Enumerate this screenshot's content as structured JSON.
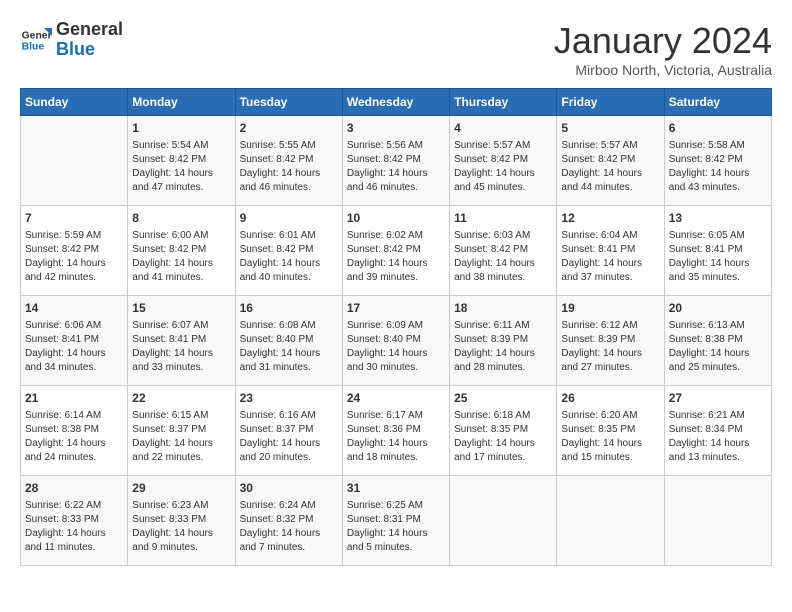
{
  "header": {
    "logo": {
      "line1": "General",
      "line2": "Blue"
    },
    "title": "January 2024",
    "subtitle": "Mirboo North, Victoria, Australia"
  },
  "weekdays": [
    "Sunday",
    "Monday",
    "Tuesday",
    "Wednesday",
    "Thursday",
    "Friday",
    "Saturday"
  ],
  "weeks": [
    [
      {
        "day": "",
        "info": ""
      },
      {
        "day": "1",
        "info": "Sunrise: 5:54 AM\nSunset: 8:42 PM\nDaylight: 14 hours\nand 47 minutes."
      },
      {
        "day": "2",
        "info": "Sunrise: 5:55 AM\nSunset: 8:42 PM\nDaylight: 14 hours\nand 46 minutes."
      },
      {
        "day": "3",
        "info": "Sunrise: 5:56 AM\nSunset: 8:42 PM\nDaylight: 14 hours\nand 46 minutes."
      },
      {
        "day": "4",
        "info": "Sunrise: 5:57 AM\nSunset: 8:42 PM\nDaylight: 14 hours\nand 45 minutes."
      },
      {
        "day": "5",
        "info": "Sunrise: 5:57 AM\nSunset: 8:42 PM\nDaylight: 14 hours\nand 44 minutes."
      },
      {
        "day": "6",
        "info": "Sunrise: 5:58 AM\nSunset: 8:42 PM\nDaylight: 14 hours\nand 43 minutes."
      }
    ],
    [
      {
        "day": "7",
        "info": "Sunrise: 5:59 AM\nSunset: 8:42 PM\nDaylight: 14 hours\nand 42 minutes."
      },
      {
        "day": "8",
        "info": "Sunrise: 6:00 AM\nSunset: 8:42 PM\nDaylight: 14 hours\nand 41 minutes."
      },
      {
        "day": "9",
        "info": "Sunrise: 6:01 AM\nSunset: 8:42 PM\nDaylight: 14 hours\nand 40 minutes."
      },
      {
        "day": "10",
        "info": "Sunrise: 6:02 AM\nSunset: 8:42 PM\nDaylight: 14 hours\nand 39 minutes."
      },
      {
        "day": "11",
        "info": "Sunrise: 6:03 AM\nSunset: 8:42 PM\nDaylight: 14 hours\nand 38 minutes."
      },
      {
        "day": "12",
        "info": "Sunrise: 6:04 AM\nSunset: 8:41 PM\nDaylight: 14 hours\nand 37 minutes."
      },
      {
        "day": "13",
        "info": "Sunrise: 6:05 AM\nSunset: 8:41 PM\nDaylight: 14 hours\nand 35 minutes."
      }
    ],
    [
      {
        "day": "14",
        "info": "Sunrise: 6:06 AM\nSunset: 8:41 PM\nDaylight: 14 hours\nand 34 minutes."
      },
      {
        "day": "15",
        "info": "Sunrise: 6:07 AM\nSunset: 8:41 PM\nDaylight: 14 hours\nand 33 minutes."
      },
      {
        "day": "16",
        "info": "Sunrise: 6:08 AM\nSunset: 8:40 PM\nDaylight: 14 hours\nand 31 minutes."
      },
      {
        "day": "17",
        "info": "Sunrise: 6:09 AM\nSunset: 8:40 PM\nDaylight: 14 hours\nand 30 minutes."
      },
      {
        "day": "18",
        "info": "Sunrise: 6:11 AM\nSunset: 8:39 PM\nDaylight: 14 hours\nand 28 minutes."
      },
      {
        "day": "19",
        "info": "Sunrise: 6:12 AM\nSunset: 8:39 PM\nDaylight: 14 hours\nand 27 minutes."
      },
      {
        "day": "20",
        "info": "Sunrise: 6:13 AM\nSunset: 8:38 PM\nDaylight: 14 hours\nand 25 minutes."
      }
    ],
    [
      {
        "day": "21",
        "info": "Sunrise: 6:14 AM\nSunset: 8:38 PM\nDaylight: 14 hours\nand 24 minutes."
      },
      {
        "day": "22",
        "info": "Sunrise: 6:15 AM\nSunset: 8:37 PM\nDaylight: 14 hours\nand 22 minutes."
      },
      {
        "day": "23",
        "info": "Sunrise: 6:16 AM\nSunset: 8:37 PM\nDaylight: 14 hours\nand 20 minutes."
      },
      {
        "day": "24",
        "info": "Sunrise: 6:17 AM\nSunset: 8:36 PM\nDaylight: 14 hours\nand 18 minutes."
      },
      {
        "day": "25",
        "info": "Sunrise: 6:18 AM\nSunset: 8:35 PM\nDaylight: 14 hours\nand 17 minutes."
      },
      {
        "day": "26",
        "info": "Sunrise: 6:20 AM\nSunset: 8:35 PM\nDaylight: 14 hours\nand 15 minutes."
      },
      {
        "day": "27",
        "info": "Sunrise: 6:21 AM\nSunset: 8:34 PM\nDaylight: 14 hours\nand 13 minutes."
      }
    ],
    [
      {
        "day": "28",
        "info": "Sunrise: 6:22 AM\nSunset: 8:33 PM\nDaylight: 14 hours\nand 11 minutes."
      },
      {
        "day": "29",
        "info": "Sunrise: 6:23 AM\nSunset: 8:33 PM\nDaylight: 14 hours\nand 9 minutes."
      },
      {
        "day": "30",
        "info": "Sunrise: 6:24 AM\nSunset: 8:32 PM\nDaylight: 14 hours\nand 7 minutes."
      },
      {
        "day": "31",
        "info": "Sunrise: 6:25 AM\nSunset: 8:31 PM\nDaylight: 14 hours\nand 5 minutes."
      },
      {
        "day": "",
        "info": ""
      },
      {
        "day": "",
        "info": ""
      },
      {
        "day": "",
        "info": ""
      }
    ]
  ]
}
